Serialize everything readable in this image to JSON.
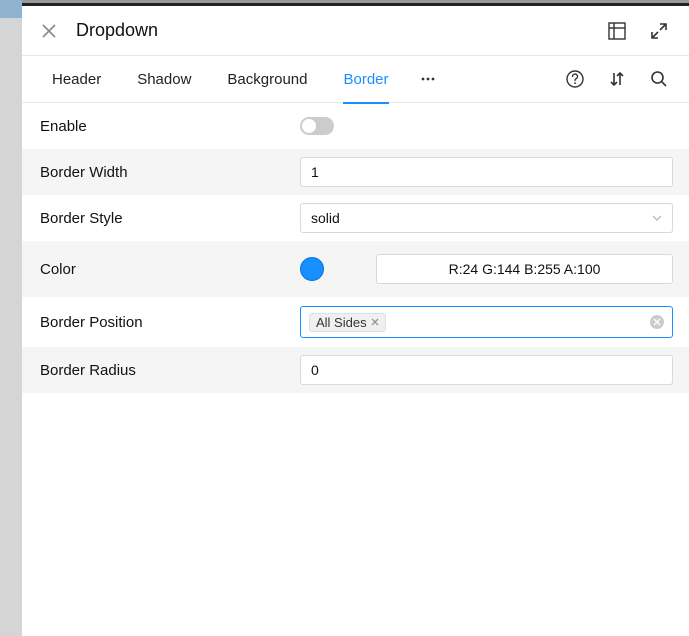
{
  "header": {
    "title": "Dropdown"
  },
  "tabs": {
    "items": [
      {
        "label": "Header",
        "active": false
      },
      {
        "label": "Shadow",
        "active": false
      },
      {
        "label": "Background",
        "active": false
      },
      {
        "label": "Border",
        "active": true
      }
    ]
  },
  "props": {
    "enable": {
      "label": "Enable",
      "value": false
    },
    "border_width": {
      "label": "Border Width",
      "value": "1"
    },
    "border_style": {
      "label": "Border Style",
      "value": "solid"
    },
    "color": {
      "label": "Color",
      "swatch": "#1890ff",
      "text": "R:24 G:144 B:255 A:100"
    },
    "border_position": {
      "label": "Border Position",
      "tags": [
        "All Sides"
      ]
    },
    "border_radius": {
      "label": "Border Radius",
      "value": "0"
    }
  }
}
